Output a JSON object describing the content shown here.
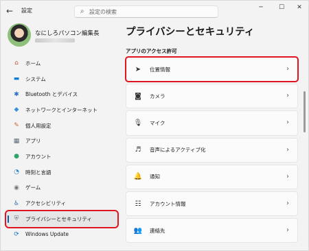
{
  "titlebar": {
    "back": "←",
    "title": "設定",
    "search_placeholder": "設定の検索",
    "minimize": "─",
    "maximize": "☐",
    "close": "✕"
  },
  "profile": {
    "name": "なにしろパソコン編集長"
  },
  "nav": [
    {
      "icon": "⌂",
      "label": "ホーム",
      "color": "#c0563b"
    },
    {
      "icon": "▬",
      "label": "システム",
      "color": "#0a7bd4"
    },
    {
      "icon": "✱",
      "label": "Bluetooth とデバイス",
      "color": "#2a6fc9"
    },
    {
      "icon": "◆",
      "label": "ネットワークとインターネット",
      "color": "#3a8fd9"
    },
    {
      "icon": "✎",
      "label": "個人用設定",
      "color": "#c46a2e"
    },
    {
      "icon": "▦",
      "label": "アプリ",
      "color": "#5d6b7a"
    },
    {
      "icon": "●",
      "label": "アカウント",
      "color": "#2fa36b"
    },
    {
      "icon": "◔",
      "label": "時刻と言語",
      "color": "#2e7fc4"
    },
    {
      "icon": "◉",
      "label": "ゲーム",
      "color": "#777777"
    },
    {
      "icon": "♿",
      "label": "アクセシビリティ",
      "color": "#2b6cb0"
    },
    {
      "icon": "⛨",
      "label": "プライバシーとセキュリティ",
      "color": "#6b7785"
    },
    {
      "icon": "⟳",
      "label": "Windows Update",
      "color": "#1a73c9"
    }
  ],
  "main": {
    "title": "プライバシーとセキュリティ",
    "section": "アプリのアクセス許可",
    "rows": [
      {
        "icon": "➤",
        "label": "位置情報"
      },
      {
        "icon": "◙",
        "label": "カメラ"
      },
      {
        "icon": "🎙",
        "label": "マイク"
      },
      {
        "icon": "♬",
        "label": "音声によるアクティブ化"
      },
      {
        "icon": "🔔",
        "label": "通知"
      },
      {
        "icon": "☷",
        "label": "アカウント情報"
      },
      {
        "icon": "👥",
        "label": "連絡先"
      }
    ],
    "chevron": "›"
  }
}
